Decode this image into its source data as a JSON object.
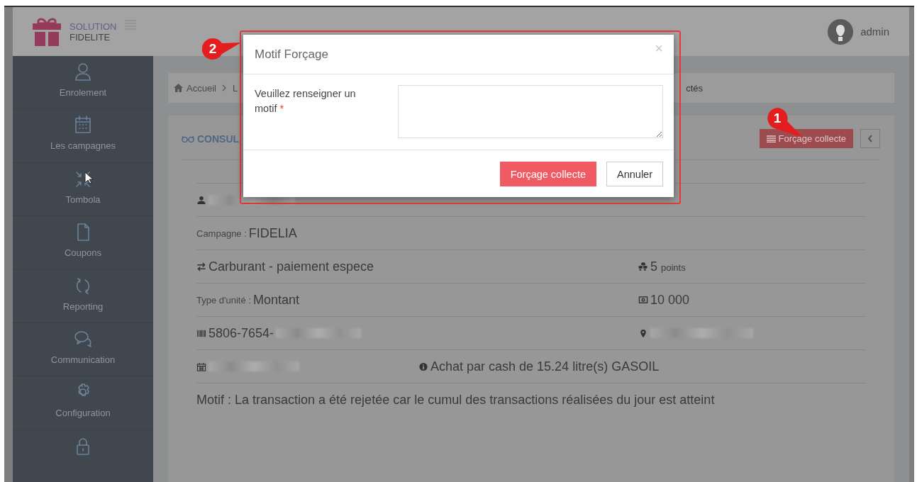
{
  "header": {
    "brand_line_1": "SOLUTION",
    "brand_line_2": "FIDELITE",
    "user": "admin"
  },
  "sidebar": {
    "items": [
      {
        "kind": "user",
        "label": "Enrolement"
      },
      {
        "kind": "calendar",
        "label": "Les campagnes"
      },
      {
        "kind": "compress",
        "label": "Tombola"
      },
      {
        "kind": "file",
        "label": "Coupons"
      },
      {
        "kind": "refresh",
        "label": "Reporting"
      },
      {
        "kind": "chat",
        "label": "Communication"
      },
      {
        "kind": "gear",
        "label": "Configuration"
      },
      {
        "kind": "lock"
      }
    ]
  },
  "breadcrumb": {
    "items": [
      "Accueil",
      "L"
    ],
    "tail": "ctés"
  },
  "card": {
    "title": "CONSUL",
    "force_button": {
      "label": "Forçage collecte",
      "callout": "1"
    },
    "rows": [
      {
        "cells": [
          {
            "kind": "user",
            "redacted": true
          }
        ]
      },
      {
        "cells": [
          {
            "label": "Campagne :",
            "value": "FIDELIA"
          }
        ]
      },
      {
        "cells": [
          {
            "kind": "exchange",
            "value": "Carburant - paiement espece"
          },
          {
            "kind": "cubes",
            "value": "5",
            "suffix": "points"
          }
        ]
      },
      {
        "cells": [
          {
            "label": "Type d'unité :",
            "value": "Montant"
          },
          {
            "kind": "money",
            "value": "10 000"
          }
        ]
      },
      {
        "cells": [
          {
            "kind": "barcode",
            "value": "5806-7654-",
            "redacted": true
          },
          {
            "kind": "pin",
            "redacted": true
          }
        ]
      },
      {
        "cells": [
          {
            "kind": "calendar",
            "redacted": true
          },
          {
            "kind": "info",
            "value": "Achat par cash de 15.24 litre(s) GASOIL"
          }
        ]
      },
      {
        "cells": [
          {
            "value": "Motif : La transaction a été rejetée car le cumul des transactions réalisées du jour est atteint"
          }
        ]
      }
    ]
  },
  "modal": {
    "title": "Motif Forçage",
    "close": "×",
    "callout": "2",
    "field_label": "Veuillez renseigner un motif",
    "required_mark": "*",
    "buttons": [
      {
        "label": "Forçage collecte",
        "kind": "primary"
      },
      {
        "label": "Annuler",
        "kind": "default"
      }
    ]
  }
}
